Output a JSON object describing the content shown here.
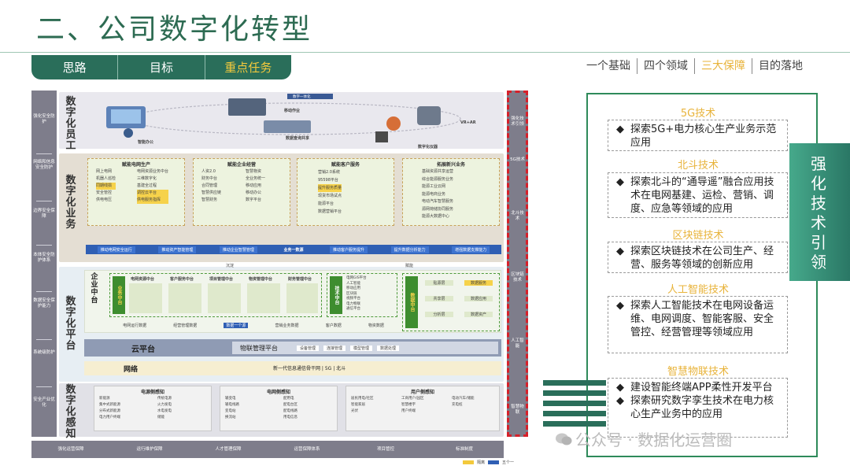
{
  "title": "二、公司数字化转型",
  "tabs": [
    {
      "label": "思路",
      "active": false
    },
    {
      "label": "目标",
      "active": false
    },
    {
      "label": "重点任务",
      "active": true
    }
  ],
  "topnav": [
    {
      "label": "一个基础",
      "active": false
    },
    {
      "label": "四个领域",
      "active": false
    },
    {
      "label": "三大保障",
      "active": true
    },
    {
      "label": "目的落地",
      "active": false
    }
  ],
  "colors": {
    "brand_green": "#2a6e5a",
    "accent_gold": "#e8b33a",
    "dashed_red": "#d6202a",
    "arch_gray": "#7e7d8b"
  },
  "arch": {
    "left_items": [
      "强化安全防护",
      "网络和信息安全防护",
      "边界安全保障",
      "本体安全防护体系",
      "数据安全保护能力",
      "系统级防护",
      "安全产业优化"
    ],
    "right_items": [
      "强化技术引领",
      "5G技术",
      "北斗技术",
      "区块链技术",
      "人工智能",
      "智慧物联"
    ],
    "layers": {
      "employee": {
        "label": "数字化员工",
        "items": [
          "智能办公",
          "移动作业",
          "数据查询共享",
          "VR+AR",
          "数字化仪器"
        ],
        "banner": "数字一体化"
      },
      "business": {
        "label": "数字化业务",
        "groups": [
          {
            "title": "赋能电网生产",
            "cells": [
              "网上电网",
              "机器人巡检",
              "同期线损",
              "安全管控",
              "供电电压",
              "调控云平台",
              "电网资源业务中台",
              "三维数字化",
              "基建全过程",
              "供电服务指挥"
            ]
          },
          {
            "title": "赋能企业经营",
            "cells": [
              "人资2.0",
              "财务中台",
              "合同管理",
              "智慧供应链",
              "智慧财务",
              "智慧物资",
              "全业务统一",
              "移动应用",
              "移动办公",
              "数字平台"
            ]
          },
          {
            "title": "赋能客户服务",
            "cells": [
              "营销2.0系统",
              "95598平台",
              "提升服务质量",
              "现货市场试点",
              "能源平台",
              "数据营销平台"
            ]
          },
          {
            "title": "拓展新兴业务",
            "cells": [
              "基础资源共享运营",
              "综合能源服务业务",
              "能源工业云网",
              "能源电商业务",
              "电动汽车智慧服务",
              "源网荷储协同服务",
              "能源大数据中心"
            ]
          }
        ],
        "bar_items": [
          "推动电网安全运行",
          "推动资产智能管理",
          "推动企业智慧管理",
          "业务一数源",
          "推动客户服务提升",
          "提升数据分析能力",
          "增强数据支撑能力"
        ]
      },
      "platform": {
        "label": "数字化平台",
        "flow_labels": [
          "沉淀",
          "赋能"
        ],
        "enterprise_middle": "企业中台",
        "business_middle": "业务中台",
        "tech_middle": "技术中台",
        "data_middle": "数据中台",
        "business_middles": [
          "电网资源中台",
          "客户服务中台",
          "项目管理中台",
          "物资管理中台",
          "财务管理中台"
        ],
        "tech_items": [
          "电网GIS平台",
          "人工智能",
          "移动应用",
          "区块链",
          "视频平台",
          "电力物联",
          "通信平台",
          "数字身份"
        ],
        "data_items": [
          "贴源层",
          "数据服务",
          "共享层",
          "数据应用",
          "分析层",
          "数据资产"
        ],
        "bottom_row": [
          "电网运行数据",
          "经营管理数据",
          "数据一个源",
          "营销业务数据",
          "客户数据",
          "物资数据"
        ],
        "cloud": "云平台",
        "iot": "物联管理平台",
        "iot_items": [
          "设备管理",
          "连接管理",
          "模型管理",
          "数据处理"
        ],
        "network_label": "网络",
        "network_text": "新一代信息通信骨干网 | 5G | 北斗"
      },
      "perception": {
        "label": "数字化感知",
        "groups": [
          {
            "title": "电源侧感知",
            "cells": [
              "新能源",
              "传统电源",
              "集中式新能源",
              "火力发电",
              "分布式新能源",
              "水电发电",
              "电力用户终端",
              "储能"
            ]
          },
          {
            "title": "电网侧感知",
            "cells": [
              "输变电",
              "配用电",
              "输电线路",
              "配电台区",
              "变电站",
              "配电线路",
              "换流站",
              "用电信息"
            ]
          },
          {
            "title": "用户侧感知",
            "cells": [
              "居民用电/社区",
              "工商用户/园区",
              "电动汽车/储能",
              "智能家居",
              "智慧楼宇",
              "充电桩",
              "光伏",
              "用户终端"
            ]
          }
        ]
      }
    },
    "footer": [
      "强化运营保障",
      "运行维护保障",
      "人才管理保障",
      "运营保障体系",
      "项目管控",
      "标准制度"
    ],
    "legend": [
      "隔离",
      "五个一"
    ]
  },
  "right_panel": {
    "band_text": "强化技术引领",
    "sections": [
      {
        "title": "5G技术",
        "bullets": [
          "探索5G+电力核心生产业务示范应用"
        ]
      },
      {
        "title": "北斗技术",
        "bullets": [
          "探索北斗的“通导遥”融合应用技术在电网基建、运检、营销、调度、应急等领域的应用"
        ]
      },
      {
        "title": "区块链技术",
        "bullets": [
          "探索区块链技术在公司生产、经营、服务等领域的创新应用"
        ]
      },
      {
        "title": "人工智能技术",
        "bullets": [
          "探索人工智能技术在电网设备运维、电网调度、智能客服、安全管控、经营管理等领域应用"
        ]
      },
      {
        "title": "智慧物联技术",
        "bullets": [
          "建设智能终端APP柔性开发平台",
          "探索研究数字孪生技术在电力核心生产业务中的应用"
        ]
      }
    ]
  },
  "watermark": "公众号 · 数据化运营圈"
}
